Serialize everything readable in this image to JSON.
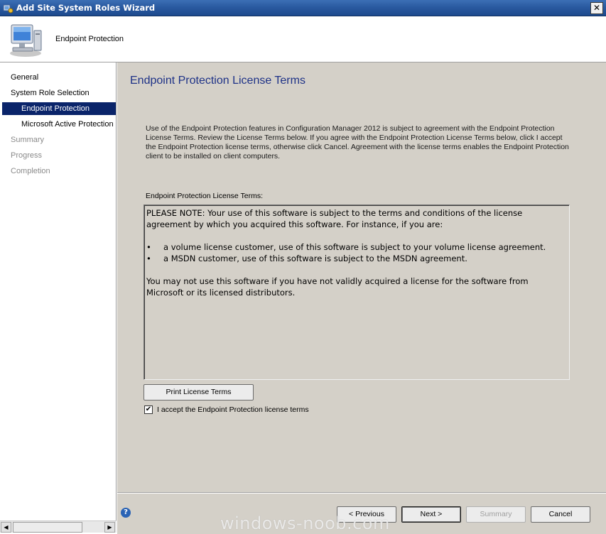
{
  "window": {
    "title": "Add Site System Roles Wizard",
    "close_label": "✕"
  },
  "header": {
    "title": "Endpoint Protection"
  },
  "nav": {
    "items": [
      {
        "label": "General"
      },
      {
        "label": "System Role Selection"
      },
      {
        "label": "Endpoint Protection"
      },
      {
        "label": "Microsoft Active Protection"
      },
      {
        "label": "Summary"
      },
      {
        "label": "Progress"
      },
      {
        "label": "Completion"
      }
    ]
  },
  "main": {
    "title": "Endpoint Protection License Terms",
    "description": "Use of the Endpoint Protection features in Configuration Manager 2012 is subject to agreement with the Endpoint Protection License Terms. Review the License Terms below. If you agree with the Endpoint Protection License Terms below, click I accept the Endpoint Protection license terms, otherwise click Cancel. Agreement with the license terms enables the Endpoint Protection client to be installed on client computers.",
    "license_label": "Endpoint Protection License Terms:",
    "license_text": {
      "note": "PLEASE NOTE: Your use of this software is subject to the terms and conditions of the license agreement by which you acquired this software.  For instance, if you are:",
      "bullets": [
        "a volume license customer, use of this software is subject to your volume license agreement.",
        "a MSDN customer, use of this software is subject to the MSDN agreement."
      ],
      "closing": "You may not use this software if you have not validly acquired a license for the software from Microsoft or its licensed distributors."
    },
    "print_button": "Print License Terms",
    "accept_checkbox": {
      "label": "I accept the Endpoint Protection license terms",
      "checked": true,
      "mark": "✔"
    }
  },
  "footer": {
    "help_glyph": "?",
    "previous": "< Previous",
    "next": "Next >",
    "summary": "Summary",
    "cancel": "Cancel"
  },
  "scrollbar": {
    "left_arrow": "◀",
    "right_arrow": "▶"
  },
  "watermark": "windows-noob.com",
  "icons": {
    "title_icon": "site-server-icon",
    "header_icon": "computer-monitor-icon",
    "bullet": "•"
  },
  "colors": {
    "titlebar": "#2a5aa0",
    "nav_active": "#0a246a",
    "title_text": "#1e3287",
    "dialog_face": "#d4d0c8"
  }
}
